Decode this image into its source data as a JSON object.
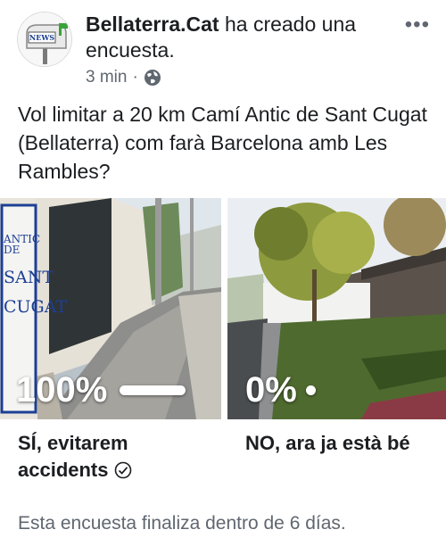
{
  "post": {
    "author": "Bellaterra.Cat",
    "action": "ha creado una encuesta.",
    "time": "3 min",
    "separator": "·",
    "privacy_icon": "globe-icon",
    "more_icon": "more-icon",
    "avatar_icon": "news-mailbox-logo"
  },
  "poll": {
    "question": "Vol limitar a 20 km Camí Antic de Sant Cugat (Bellaterra) com farà Barcelona amb Les Rambles?",
    "options": [
      {
        "label": "SÍ, evitarem accidents",
        "percent_text": "100%",
        "percent": 100,
        "selected": true,
        "sign_text": [
          "ANTIC DE",
          "SANT",
          "CUGAT"
        ]
      },
      {
        "label": "NO, ara ja està bé",
        "percent_text": "0%",
        "percent": 0,
        "selected": false
      }
    ],
    "footer": "Esta encuesta finaliza dentro de 6 días."
  },
  "colors": {
    "text": "#1c1e21",
    "secondary": "#606770"
  }
}
